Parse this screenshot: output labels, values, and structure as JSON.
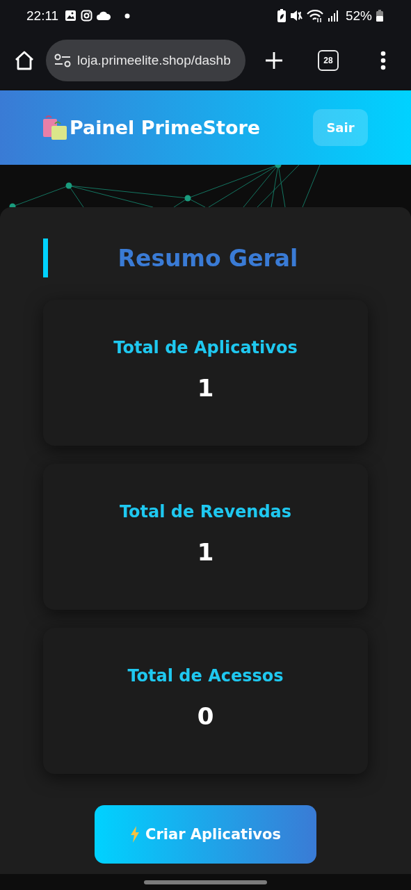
{
  "status_bar": {
    "time": "22:11",
    "battery": "52%"
  },
  "browser": {
    "url": "loja.primeelite.shop/dashb",
    "tab_count": "28"
  },
  "header": {
    "title": "Painel PrimeStore",
    "logout": "Sair"
  },
  "summary": {
    "title": "Resumo Geral",
    "stats": [
      {
        "label": "Total de Aplicativos",
        "value": "1"
      },
      {
        "label": "Total de Revendas",
        "value": "1"
      },
      {
        "label": "Total de Acessos",
        "value": "0"
      }
    ]
  },
  "action_button": "Criar Aplicativos"
}
